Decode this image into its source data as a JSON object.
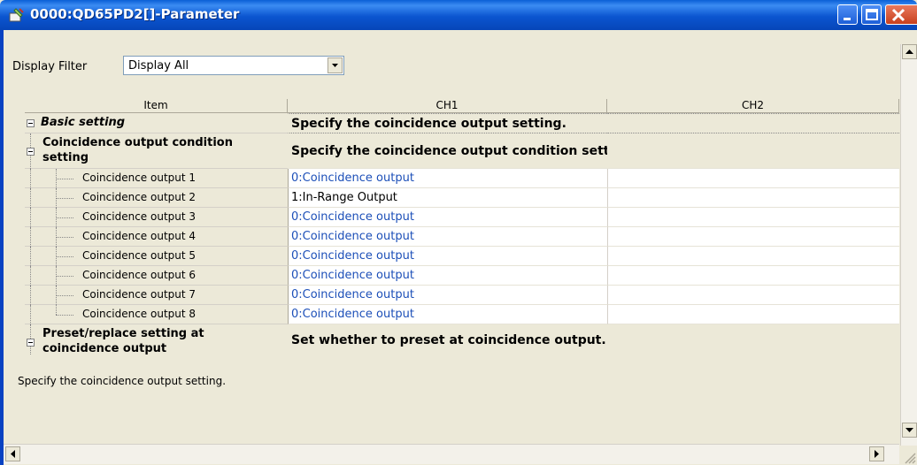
{
  "window": {
    "title": "0000:QD65PD2[]-Parameter"
  },
  "filter": {
    "label": "Display Filter",
    "value": "Display All"
  },
  "columns": {
    "item": "Item",
    "ch1": "CH1",
    "ch2": "CH2"
  },
  "rows": {
    "basic": {
      "item": "Basic setting",
      "ch1": "Specify the coincidence output setting."
    },
    "coin_cond": {
      "item_line1": "Coincidence output condition",
      "item_line2": "setting",
      "ch1": "Specify the coincidence output condition setting."
    },
    "outputs": [
      {
        "item": "Coincidence output 1",
        "ch1": "0:Coincidence output"
      },
      {
        "item": "Coincidence output 2",
        "ch1": "1:In-Range Output"
      },
      {
        "item": "Coincidence output 3",
        "ch1": "0:Coincidence output"
      },
      {
        "item": "Coincidence output 4",
        "ch1": "0:Coincidence output"
      },
      {
        "item": "Coincidence output 5",
        "ch1": "0:Coincidence output"
      },
      {
        "item": "Coincidence output 6",
        "ch1": "0:Coincidence output"
      },
      {
        "item": "Coincidence output 7",
        "ch1": "0:Coincidence output"
      },
      {
        "item": "Coincidence output 8",
        "ch1": "0:Coincidence output"
      }
    ],
    "preset": {
      "item_line1": "Preset/replace setting at",
      "item_line2": "coincidence output",
      "ch1": "Set whether to preset at coincidence output."
    }
  },
  "description": "Specify the coincidence output setting.",
  "colors": {
    "titlebar": "#0a5fd6",
    "value_blue": "#1c4fb8",
    "panel": "#ece9d8"
  }
}
